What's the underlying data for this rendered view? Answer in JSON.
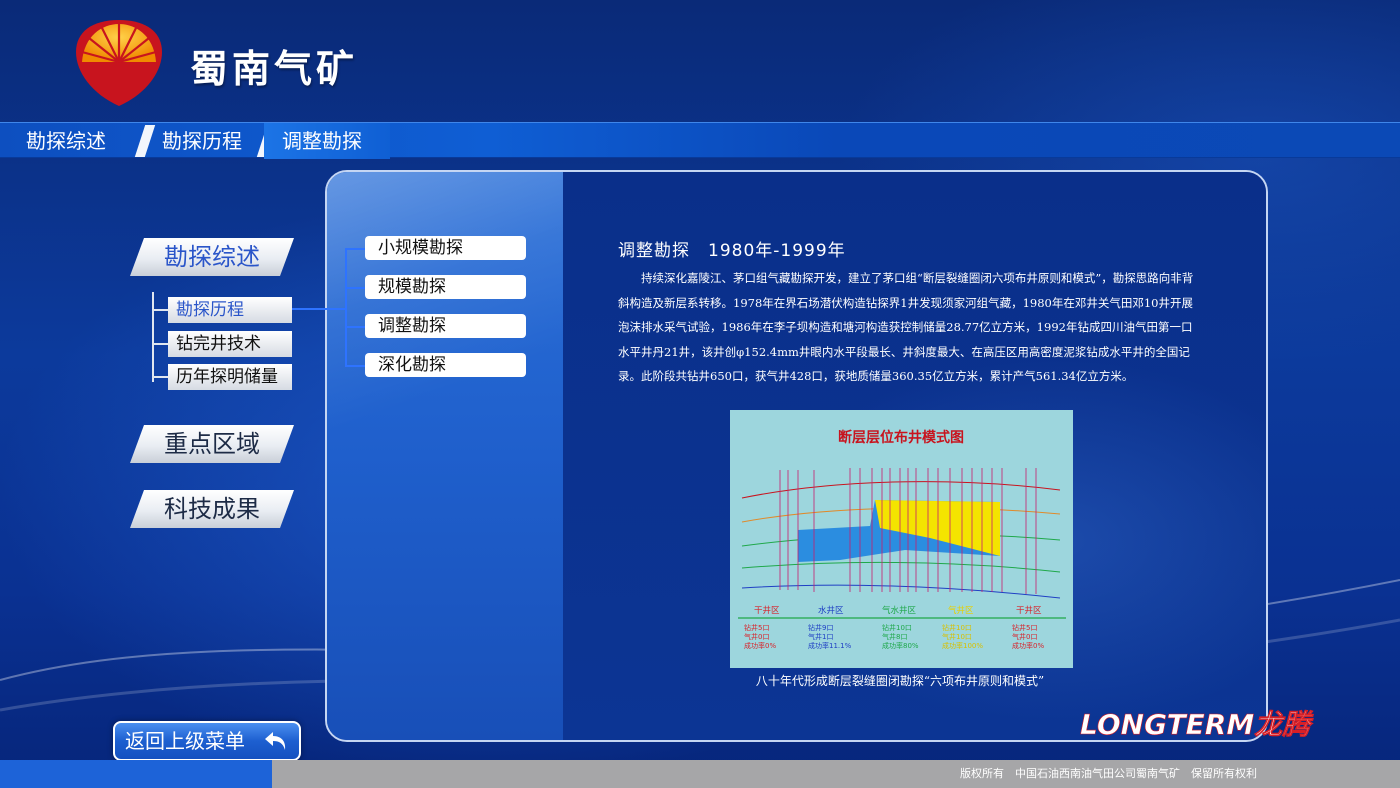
{
  "header": {
    "app_title": "蜀南气矿",
    "logo_icon": "petrochina-sun-logo-icon"
  },
  "breadcrumb": [
    "勘探综述",
    "勘探历程",
    "调整勘探"
  ],
  "sidebar": {
    "main_items": [
      {
        "label": "勘探综述",
        "active": true
      },
      {
        "label": "重点区域",
        "active": false
      },
      {
        "label": "科技成果",
        "active": false
      }
    ],
    "sub_items": [
      {
        "label": "勘探历程",
        "active": true
      },
      {
        "label": "钻完井技术",
        "active": false
      },
      {
        "label": "历年探明储量",
        "active": false
      }
    ]
  },
  "stages": [
    "小规模勘探",
    "规模勘探",
    "调整勘探",
    "深化勘探"
  ],
  "content": {
    "title": "调整勘探　1980年-1999年",
    "body": "持续深化嘉陵江、茅口组气藏勘探开发，建立了茅口组“断层裂缝圈闭六项布井原则和模式”，勘探思路向非背斜构造及新层系转移。1978年在界石场潜伏构造钻探界1井发现须家河组气藏，1980年在邓井关气田邓10井开展泡沫排水采气试验，1986年在李子坝构造和塘河构造获控制储量28.77亿立方米，1992年钻成四川油气田第一口水平井丹21井，该井创φ152.4mm井眼内水平段最长、井斜度最大、在高压区用高密度泥浆钻成水平井的全国记录。此阶段共钻井650口，获气井428口，获地质储量360.35亿立方米，累计产气561.34亿立方米。",
    "figure": {
      "title": "断层层位布井模式图",
      "zones": [
        {
          "name": "干井区",
          "lines": [
            "钻井5口",
            "气井0口",
            "成功率0%"
          ],
          "color": "#d8232a"
        },
        {
          "name": "水井区",
          "lines": [
            "钻井9口",
            "气井1口",
            "成功率11.1%"
          ],
          "color": "#1f3fc4"
        },
        {
          "name": "气水井区",
          "lines": [
            "钻井10口",
            "气井8口",
            "成功率80%"
          ],
          "color": "#1fa84a"
        },
        {
          "name": "气井区",
          "lines": [
            "钻井10口",
            "气井10口",
            "成功率100%"
          ],
          "color": "#e8d000"
        },
        {
          "name": "干井区",
          "lines": [
            "钻井5口",
            "气井0口",
            "成功率0%"
          ],
          "color": "#d8232a"
        }
      ],
      "caption": "八十年代形成断层裂缝圈闭勘探“六项布井原则和模式”"
    }
  },
  "footer": {
    "back_label": "返回上级菜单",
    "brand": "LONGTERM龙腾",
    "copyright": "版权所有　中国石油西南油气田公司蜀南气矿　保留所有权利"
  },
  "colors": {
    "accent": "#1d63d8",
    "active_text": "#2a55c9",
    "brand_red": "#d81f26",
    "logo_red": "#c8141e",
    "logo_yellow": "#f6b400"
  }
}
